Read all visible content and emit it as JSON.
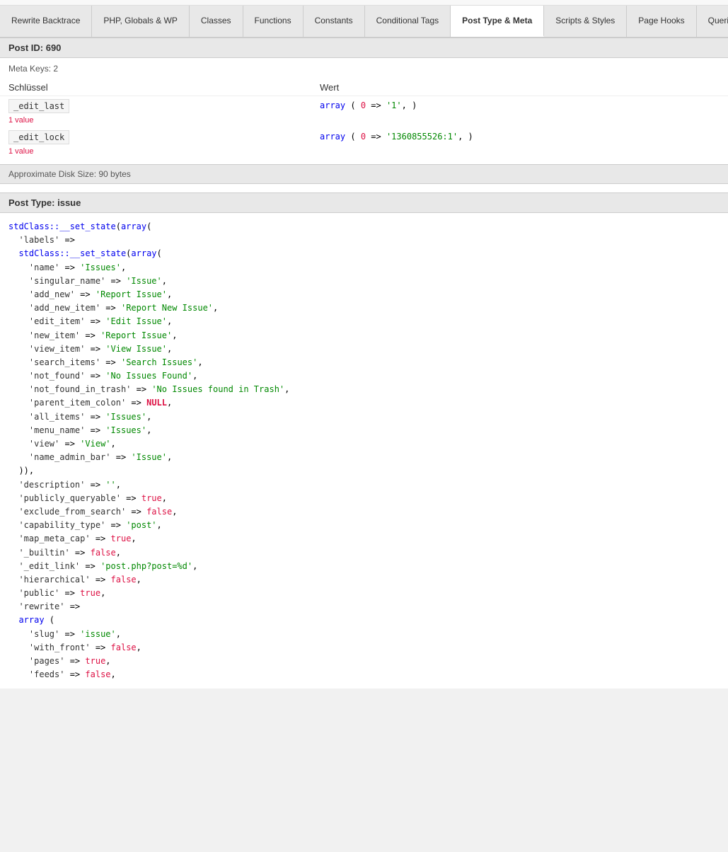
{
  "topStrip": true,
  "tabs": [
    {
      "id": "rewrite-backtrace",
      "label": "Rewrite Backtrace",
      "active": false
    },
    {
      "id": "php-globals-wp",
      "label": "PHP, Globals & WP",
      "active": false
    },
    {
      "id": "classes",
      "label": "Classes",
      "active": false
    },
    {
      "id": "functions",
      "label": "Functions",
      "active": false
    },
    {
      "id": "constants",
      "label": "Constants",
      "active": false
    },
    {
      "id": "conditional-tags",
      "label": "Conditional Tags",
      "active": false
    },
    {
      "id": "post-type-meta",
      "label": "Post Type & Meta",
      "active": true
    },
    {
      "id": "scripts-styles",
      "label": "Scripts & Styles",
      "active": false
    },
    {
      "id": "page-hooks",
      "label": "Page Hooks",
      "active": false
    },
    {
      "id": "queries",
      "label": "Queries",
      "active": false
    }
  ],
  "postSection": {
    "header": "Post ID: 690",
    "metaKeys": "Meta Keys: 2",
    "colSchluessel": "Schlüssel",
    "colWert": "Wert",
    "rows": [
      {
        "key": "_edit_last",
        "valueCount": "1 value",
        "code": "array (\n  0 => '1',\n)"
      },
      {
        "key": "_edit_lock",
        "valueCount": "1 value",
        "code": "array (\n  0 => '1360855526:1',\n)"
      }
    ],
    "diskSize": "Approximate Disk Size: 90 bytes"
  },
  "postTypeSection": {
    "header": "Post Type: issue",
    "code": "stdClass::__set_state(array(\n  'labels' =>\n  stdClass::__set_state(array(\n    'name' => 'Issues',\n    'singular_name' => 'Issue',\n    'add_new' => 'Report Issue',\n    'add_new_item' => 'Report New Issue',\n    'edit_item' => 'Edit Issue',\n    'new_item' => 'Report Issue',\n    'view_item' => 'View Issue',\n    'search_items' => 'Search Issues',\n    'not_found' => 'No Issues Found',\n    'not_found_in_trash' => 'No Issues found in Trash',\n    'parent_item_colon' => NULL,\n    'all_items' => 'Issues',\n    'menu_name' => 'Issues',\n    'view' => 'View',\n    'name_admin_bar' => 'Issue',\n  )),\n  'description' => '',\n  'publicly_queryable' => true,\n  'exclude_from_search' => false,\n  'capability_type' => 'post',\n  'map_meta_cap' => true,\n  '_builtin' => false,\n  '_edit_link' => 'post.php?post=%d',\n  'hierarchical' => false,\n  'public' => true,\n  'rewrite' =>\n  array (\n    'slug' => 'issue',\n    'with_front' => false,\n    'pages' => true,\n    'feeds' => false,"
  }
}
